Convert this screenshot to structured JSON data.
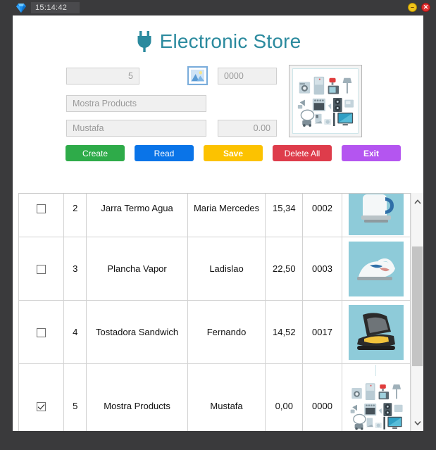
{
  "titlebar": {
    "clock": "15:14:42",
    "app_icon": "gem-icon",
    "minimize_glyph": "–",
    "close_glyph": "✕"
  },
  "header": {
    "title": "Electronic Store",
    "logo_icon": "plug-icon",
    "accent_color": "#2b8a9e"
  },
  "form": {
    "id_value": "5",
    "code_value": "0000",
    "name_value": "Mostra Products",
    "supplier_value": "Mustafa",
    "price_value": "0.00",
    "image_button_icon": "picture-icon",
    "preview_icon": "appliances-collage"
  },
  "toolbar": {
    "buttons": [
      {
        "label": "Create",
        "color": "#2eab49"
      },
      {
        "label": "Read",
        "color": "#0a74e8"
      },
      {
        "label": "Save",
        "color": "#fcc200"
      },
      {
        "label": "Delete All",
        "color": "#de3c4b"
      },
      {
        "label": "Exit",
        "color": "#b455f0"
      }
    ]
  },
  "table": {
    "rows": [
      {
        "checked": false,
        "id": "2",
        "name": "Jarra Termo Agua",
        "supplier": "Maria Mercedes",
        "price": "15,34",
        "code": "0002",
        "image": "kettle-icon"
      },
      {
        "checked": false,
        "id": "3",
        "name": "Plancha Vapor",
        "supplier": "Ladislao",
        "price": "22,50",
        "code": "0003",
        "image": "iron-icon"
      },
      {
        "checked": false,
        "id": "4",
        "name": "Tostadora Sandwich",
        "supplier": "Fernando",
        "price": "14,52",
        "code": "0017",
        "image": "sandwich-maker-icon"
      },
      {
        "checked": true,
        "id": "5",
        "name": "Mostra Products",
        "supplier": "Mustafa",
        "price": "0,00",
        "code": "0000",
        "image": "appliances-collage"
      }
    ]
  },
  "scrollbar": {
    "up_icon": "chevron-up-icon",
    "down_icon": "chevron-down-icon"
  }
}
